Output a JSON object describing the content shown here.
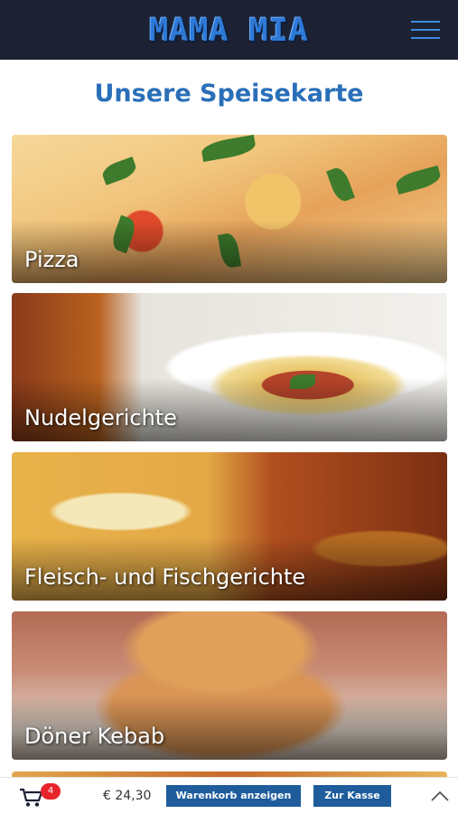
{
  "header": {
    "logo_text": "MAMA MIA",
    "menu_icon": "hamburger-icon",
    "background": "#1c2233",
    "logo_color": "#2f79d6"
  },
  "page": {
    "title": "Unsere Speisekarte",
    "title_color": "#2a6fb8"
  },
  "categories": [
    {
      "label": "Pizza"
    },
    {
      "label": "Nudelgerichte"
    },
    {
      "label": "Fleisch- und Fischgerichte"
    },
    {
      "label": "Döner Kebab"
    }
  ],
  "cart": {
    "icon": "shopping-cart-icon",
    "count": "4",
    "total": "€ 24,30",
    "view_cart_label": "Warenkorb anzeigen",
    "checkout_label": "Zur Kasse",
    "scroll_up_icon": "chevron-up-icon",
    "button_color": "#1e5c9c",
    "badge_color": "#e8242b"
  }
}
